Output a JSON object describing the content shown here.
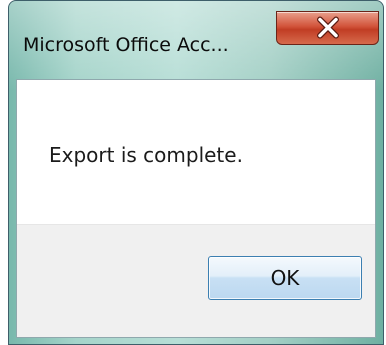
{
  "dialog": {
    "title": "Microsoft Office Acc...",
    "message": "Export is complete.",
    "ok_label": "OK",
    "close_icon": "close-x-icon"
  },
  "colors": {
    "close_button": "#c94a31",
    "ok_button_border": "#3c7fb1",
    "footer_background": "#f0f0f0"
  }
}
